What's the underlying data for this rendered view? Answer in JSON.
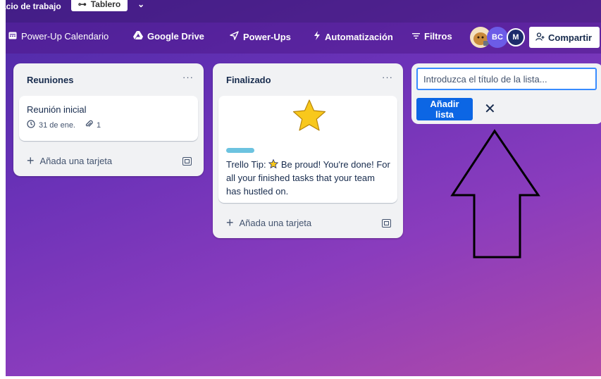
{
  "header": {
    "workspace_label": "acio de trabajo",
    "view_tab_label": "Tablero",
    "view_tab_icon": "board-icon",
    "dropdown_icon": "chevron-down-icon"
  },
  "toolbar": {
    "calendar_label": "Power-Up Calendario",
    "drive_label": "Google Drive",
    "powerups_label": "Power-Ups",
    "automation_label": "Automatización",
    "filters_label": "Filtros",
    "avatars": [
      {
        "initials": "",
        "color": "#c9a46b",
        "kind": "photo"
      },
      {
        "initials": "BC",
        "color": "#6c5ce7"
      },
      {
        "initials": "M",
        "color": "#1d2b6b"
      }
    ],
    "share_label": "Compartir"
  },
  "lists": [
    {
      "title": "Reuniones",
      "menu": "···",
      "cards": [
        {
          "title": "Reunión inicial",
          "due": "31 de ene.",
          "attachments": "1"
        }
      ],
      "add_card_label": "Añada una tarjeta"
    },
    {
      "title": "Finalizado",
      "menu": "···",
      "cards": [
        {
          "cover_icon": "star-icon",
          "label_color": "#6cc3e0",
          "text_1": "Trello Tip:",
          "text_2": "Be proud! You're done! For all your finished tasks that your team has hustled on."
        }
      ],
      "add_card_label": "Añada una tarjeta"
    }
  ],
  "new_list": {
    "placeholder": "Introduzca el título de la lista...",
    "add_label": "Añadir lista",
    "close_label": "✕"
  },
  "colors": {
    "accent": "#0c66e4",
    "list_bg": "#f1f2f4",
    "board_bg_start": "#4b2aa6",
    "board_bg_end": "#b04aa8"
  }
}
